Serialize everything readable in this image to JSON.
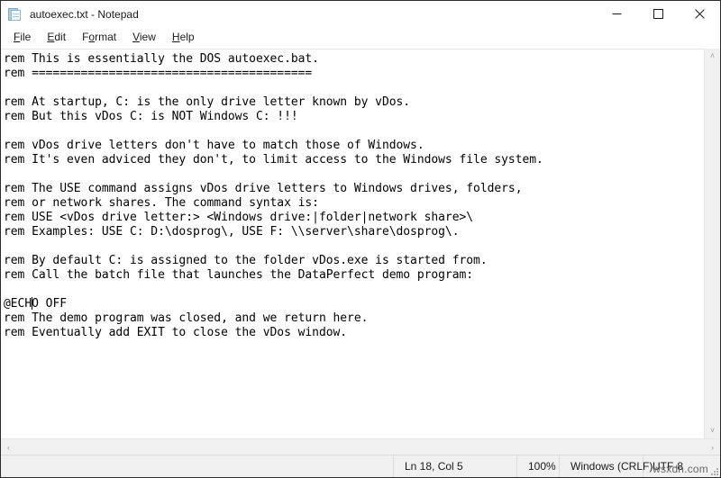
{
  "window": {
    "title": "autoexec.txt - Notepad",
    "icon": "notepad-document-icon",
    "controls": {
      "minimize": "minimize-button",
      "maximize": "maximize-button",
      "close": "close-button"
    }
  },
  "menu": {
    "items": [
      {
        "label": "File",
        "accesskey": "F"
      },
      {
        "label": "Edit",
        "accesskey": "E"
      },
      {
        "label": "Format",
        "accesskey": "o"
      },
      {
        "label": "View",
        "accesskey": "V"
      },
      {
        "label": "Help",
        "accesskey": "H"
      }
    ]
  },
  "document": {
    "lines": [
      "rem This is essentially the DOS autoexec.bat.",
      "rem ========================================",
      "",
      "rem At startup, C: is the only drive letter known by vDos.",
      "rem But this vDos C: is NOT Windows C: !!!",
      "",
      "rem vDos drive letters don't have to match those of Windows.",
      "rem It's even adviced they don't, to limit access to the Windows file system.",
      "",
      "rem The USE command assigns vDos drive letters to Windows drives, folders,",
      "rem or network shares. The command syntax is:",
      "rem USE <vDos drive letter:> <Windows drive:|folder|network share>\\",
      "rem Examples: USE C: D:\\dosprog\\, USE F: \\\\server\\share\\dosprog\\.",
      "",
      "rem By default C: is assigned to the folder vDos.exe is started from.",
      "rem Call the batch file that launches the DataPerfect demo program:",
      "",
      "@ECHO OFF",
      "rem The demo program was closed, and we return here.",
      "rem Eventually add EXIT to close the vDos window."
    ],
    "caret": {
      "line_index": 17,
      "column_chars": 4
    }
  },
  "scrollbars": {
    "vertical": {
      "up_arrow": "˄",
      "down_arrow": "˅"
    },
    "horizontal": {
      "left_arrow": "‹",
      "right_arrow": "›"
    }
  },
  "statusbar": {
    "position": "Ln 18, Col 5",
    "zoom": "100%",
    "line_ending": "Windows (CRLF)",
    "encoding": "UTF-8"
  },
  "watermark": {
    "text": "wsxdn.com"
  },
  "colors": {
    "window_border": "#2b2b2b",
    "chrome_bg": "#ffffff",
    "text": "#1b1b1b",
    "editor_text": "#000000",
    "statusbar_bg": "#f0f0f0",
    "separator": "#dcdcdc",
    "scrollbar_bg": "#f0f0f0",
    "scrollbar_arrow": "#a0a0a0",
    "icon_blue": "#a8cfe8"
  }
}
